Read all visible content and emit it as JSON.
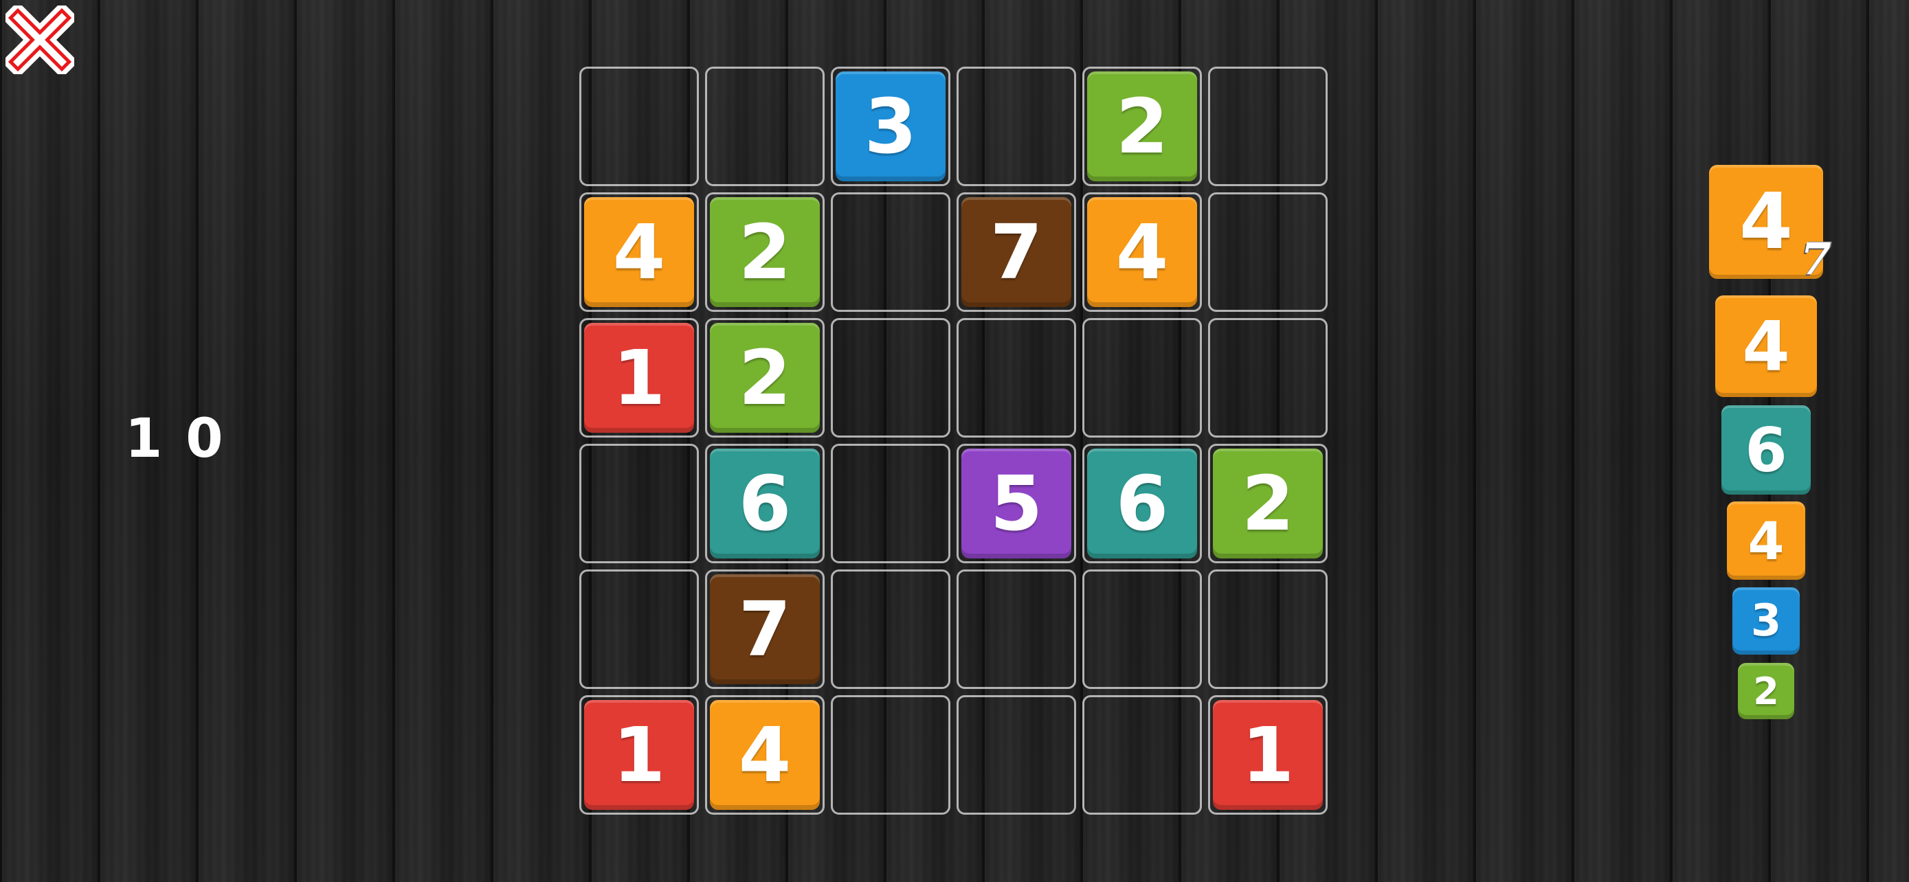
{
  "close_icon": "close-x-icon",
  "score": "10",
  "colors": {
    "1": "#e23b34",
    "2": "#76b32f",
    "3": "#1d8fd8",
    "4": "#f99b16",
    "5": "#8f44c6",
    "6": "#2f9b92",
    "7": "#6b3a12"
  },
  "board": [
    [
      "",
      "",
      "3",
      "",
      "2",
      ""
    ],
    [
      "4",
      "2",
      "",
      "7",
      "4",
      ""
    ],
    [
      "1",
      "2",
      "",
      "",
      "",
      ""
    ],
    [
      "",
      "6",
      "",
      "5",
      "6",
      "2"
    ],
    [
      "",
      "7",
      "",
      "",
      "",
      ""
    ],
    [
      "1",
      "4",
      "",
      "",
      "",
      "1"
    ]
  ],
  "queue": [
    "4",
    "4",
    "6",
    "4",
    "3",
    "2"
  ],
  "queue_hint": "7"
}
